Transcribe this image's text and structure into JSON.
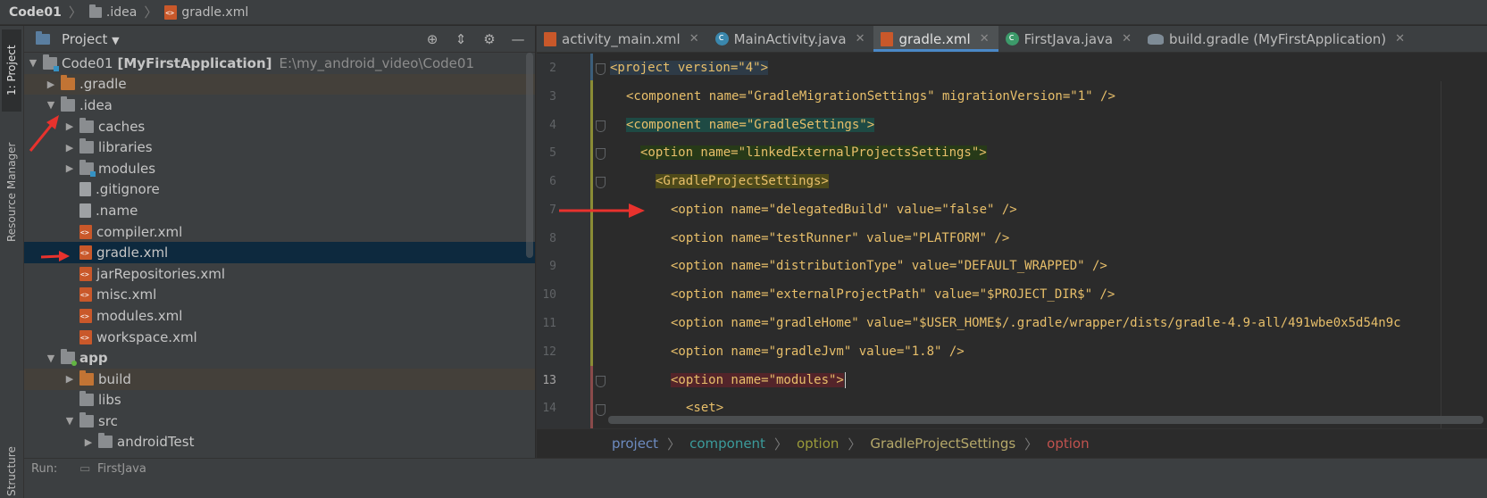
{
  "navbar": {
    "crumbs": [
      "Code01",
      ".idea",
      "gradle.xml"
    ]
  },
  "stripe": {
    "project_tab": "1: Project",
    "resource_tab": "Resource Manager",
    "structure_tab": "Structure"
  },
  "project_panel": {
    "title": "Project",
    "tree": [
      {
        "label": "Code01",
        "extra": "[MyFirstApplication]",
        "path": "E:\\my_android_video\\Code01"
      },
      {
        "label": ".gradle"
      },
      {
        "label": ".idea"
      },
      {
        "label": "caches"
      },
      {
        "label": "libraries"
      },
      {
        "label": "modules"
      },
      {
        "label": ".gitignore"
      },
      {
        "label": ".name"
      },
      {
        "label": "compiler.xml"
      },
      {
        "label": "gradle.xml"
      },
      {
        "label": "jarRepositories.xml"
      },
      {
        "label": "misc.xml"
      },
      {
        "label": "modules.xml"
      },
      {
        "label": "workspace.xml"
      },
      {
        "label": "app"
      },
      {
        "label": "build"
      },
      {
        "label": "libs"
      },
      {
        "label": "src"
      },
      {
        "label": "androidTest"
      }
    ]
  },
  "runbar": {
    "label": "Run:",
    "config": "FirstJava"
  },
  "editor": {
    "tabs": [
      {
        "label": "activity_main.xml"
      },
      {
        "label": "MainActivity.java"
      },
      {
        "label": "gradle.xml"
      },
      {
        "label": "FirstJava.java"
      },
      {
        "label": "build.gradle (MyFirstApplication)"
      }
    ],
    "line_numbers": [
      "2",
      "3",
      "4",
      "5",
      "6",
      "7",
      "8",
      "9",
      "10",
      "11",
      "12",
      "13",
      "14"
    ],
    "code": [
      "<project version=\"4\">",
      "<component name=\"GradleMigrationSettings\" migrationVersion=\"1\" />",
      "<component name=\"GradleSettings\">",
      "<option name=\"linkedExternalProjectsSettings\">",
      "<GradleProjectSettings>",
      "<option name=\"delegatedBuild\" value=\"false\" />",
      "<option name=\"testRunner\" value=\"PLATFORM\" />",
      "<option name=\"distributionType\" value=\"DEFAULT_WRAPPED\" />",
      "<option name=\"externalProjectPath\" value=\"$PROJECT_DIR$\" />",
      "<option name=\"gradleHome\" value=\"$USER_HOME$/.gradle/wrapper/dists/gradle-4.9-all/491wbe0x5d54n9c",
      "<option name=\"gradleJvm\" value=\"1.8\" />",
      "<option name=\"modules\">",
      "<set>"
    ],
    "breadcrumb": [
      "project",
      "component",
      "option",
      "GradleProjectSettings",
      "option"
    ]
  },
  "colors": {
    "annotation_arrow": "#e8322d",
    "active_tab_underline": "#4a88c7",
    "selection": "#0d293e"
  }
}
